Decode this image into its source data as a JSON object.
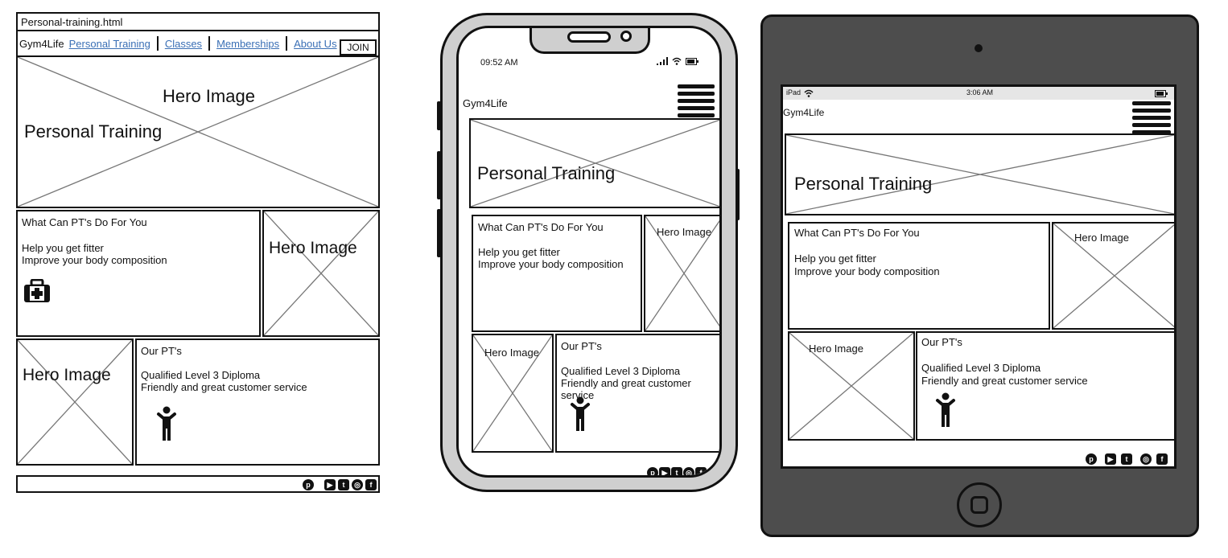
{
  "desktop": {
    "window_title": "Personal-training.html",
    "brand": "Gym4Life",
    "nav": [
      "Personal Training",
      "Classes",
      "Memberships",
      "About Us"
    ],
    "join_label": "JOIN",
    "hero_image_label": "Hero Image",
    "hero_title": "Personal Training",
    "pt_card": {
      "heading": "What Can PT's Do For You",
      "line1": "Help you get fitter",
      "line2": "Improve your body composition"
    },
    "side_image_label": "Hero Image",
    "ours_image_label": "Hero Image",
    "ours_card": {
      "heading": "Our PT's",
      "line1": "Qualified Level 3 Diploma",
      "line2": "Friendly and great customer service"
    }
  },
  "phone": {
    "time": "09:52 AM",
    "brand": "Gym4Life",
    "hero_title": "Personal Training",
    "pt_card": {
      "heading": "What Can PT's Do For You",
      "line1": "Help you get fitter",
      "line2": "Improve your body composition"
    },
    "side_image_label": "Hero Image",
    "ours_image_label": "Hero Image",
    "ours_card": {
      "heading": "Our PT's",
      "line1": "Qualified Level 3 Diploma",
      "line2": "Friendly and great customer",
      "line3": "service"
    }
  },
  "tablet": {
    "device_label": "iPad",
    "time": "3:06 AM",
    "brand": "Gym4Life",
    "hero_title": "Personal Training",
    "pt_card": {
      "heading": "What Can PT's Do For You",
      "line1": "Help you get fitter",
      "line2": "Improve your body composition"
    },
    "side_image_label": "Hero Image",
    "ours_image_label": "Hero Image",
    "ours_card": {
      "heading": "Our PT's",
      "line1": "Qualified Level 3 Diploma",
      "line2": "Friendly and great customer service"
    }
  },
  "icons": [
    "medical-kit-icon",
    "person-icon",
    "pinterest-icon",
    "youtube-icon",
    "twitter-icon",
    "instagram-icon",
    "facebook-icon",
    "hamburger-menu-icon",
    "wifi-icon",
    "battery-icon",
    "signal-icon"
  ]
}
